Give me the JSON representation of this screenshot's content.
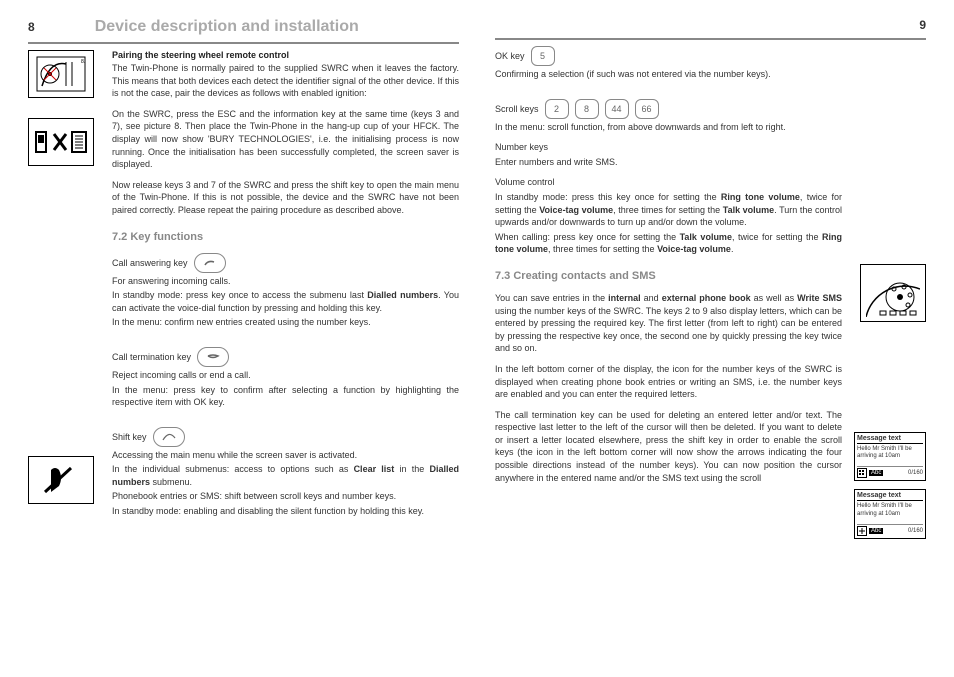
{
  "doc_title": "Device description and installation",
  "page_left": "8",
  "page_right": "9",
  "left": {
    "pairing_head": "Pairing the steering wheel remote control",
    "pairing_p1": "The Twin-Phone is normally paired to the supplied SWRC when it leaves the factory. This means that both devices each detect the identifier signal of the other device. If this is not the case, pair the devices as follows with enabled ignition:",
    "pairing_p2": "On the SWRC, press the ESC and the information key at the same time (keys 3 and 7), see picture 8. Then place the Twin-Phone in the hang-up cup of your HFCK. The display will now show 'BURY TECHNOLOGIES', i.e. the initialising process is now running. Once the initialisation has been successfully completed, the screen saver is displayed.",
    "pairing_p3": "Now release keys 3 and 7 of the SWRC and press the shift key to open the main menu of the Twin-Phone. If this is not possible, the device and the SWRC have not been paired correctly. Please repeat the pairing procedure as described above.",
    "sec72": "7.2  Key functions",
    "call_ans_label": "Call answering key",
    "call_ans_p1": "For answering incoming calls.",
    "call_ans_p2a": "In standby mode: press key once to access the submenu last ",
    "call_ans_p2b": "Dialled numbers",
    "call_ans_p2c": ". You can activate the voice-dial function by pressing and holding this key.",
    "call_ans_p3": "In the menu: confirm new entries created using the number keys.",
    "call_term_label": "Call termination key",
    "call_term_p1": "Reject incoming calls or end a call.",
    "call_term_p2": "In the menu: press key to confirm after selecting a function by highlighting the respective item with OK key.",
    "shift_label": "Shift key",
    "shift_p1": "Accessing the main menu while the screen saver is activated.",
    "shift_p2a": "In the individual submenus: access to options such as ",
    "shift_p2b": "Clear list",
    "shift_p2c": " in the ",
    "shift_p2d": "Dialled numbers",
    "shift_p2e": " submenu.",
    "shift_p3": "Phonebook entries or SMS: shift between scroll keys and number keys.",
    "shift_p4": "In standby mode: enabling and disabling the silent function by holding this key."
  },
  "right": {
    "ok_label": "OK key",
    "ok_key_glyph": "5",
    "ok_p1": "Confirming a selection (if such was not entered via the number keys).",
    "scroll_label": "Scroll keys",
    "scroll_keys": [
      "2",
      "8",
      "44",
      "66"
    ],
    "scroll_p1": "In the menu: scroll function, from above downwards and from left to right.",
    "num_label": "Number keys",
    "num_p1": "Enter numbers and write SMS.",
    "vol_label": "Volume control",
    "vol_p1a": "In standby mode: press this key once for setting the ",
    "vol_p1b": "Ring tone volume",
    "vol_p1c": ", twice for setting the ",
    "vol_p1d": "Voice-tag volume",
    "vol_p1e": ", three times for setting the ",
    "vol_p1f": "Talk volume",
    "vol_p1g": ". Turn the control upwards and/or downwards to turn up and/or down the volume.",
    "vol_p2a": "When calling: press key once for setting the ",
    "vol_p2b": "Talk volume",
    "vol_p2c": ", twice for setting the ",
    "vol_p2d": "Ring tone volume",
    "vol_p2e": ", three times for setting the ",
    "vol_p2f": "Voice-tag volume",
    "vol_p2g": ".",
    "sec73": "7.3  Creating contacts and SMS",
    "c73_p1a": "You can save entries in the ",
    "c73_p1b": "internal",
    "c73_p1c": " and ",
    "c73_p1d": "external phone book",
    "c73_p1e": " as well as ",
    "c73_p1f": "Write SMS",
    "c73_p1g": " using the number keys of the SWRC. The keys 2 to 9 also display letters, which can be entered by pressing the required key. The first letter (from left to right) can be entered by pressing the respective key once, the second one by quickly pressing the key twice and so on.",
    "c73_p2": "In the left bottom corner of the display, the icon for the number keys of the SWRC is displayed when creating phone book entries or writing an SMS, i.e. the number keys are enabled and you can enter the required letters.",
    "c73_p3": "The call termination key can be used for deleting an entered letter and/or text. The respective last letter to the left of the cursor will then be deleted. If you want to delete or insert a letter located elsewhere, press the shift key in order to enable the scroll keys (the icon in the left bottom corner will now show the arrows indicating the four possible directions instead of the number keys). You can now position the cursor anywhere in the entered name and/or the SMS text using the scroll",
    "msg_title": "Message text",
    "msg_body": "Hello Mr Smith I'll be arriving at 10am",
    "abc_label": "Abc",
    "frac_label": "0/160"
  }
}
